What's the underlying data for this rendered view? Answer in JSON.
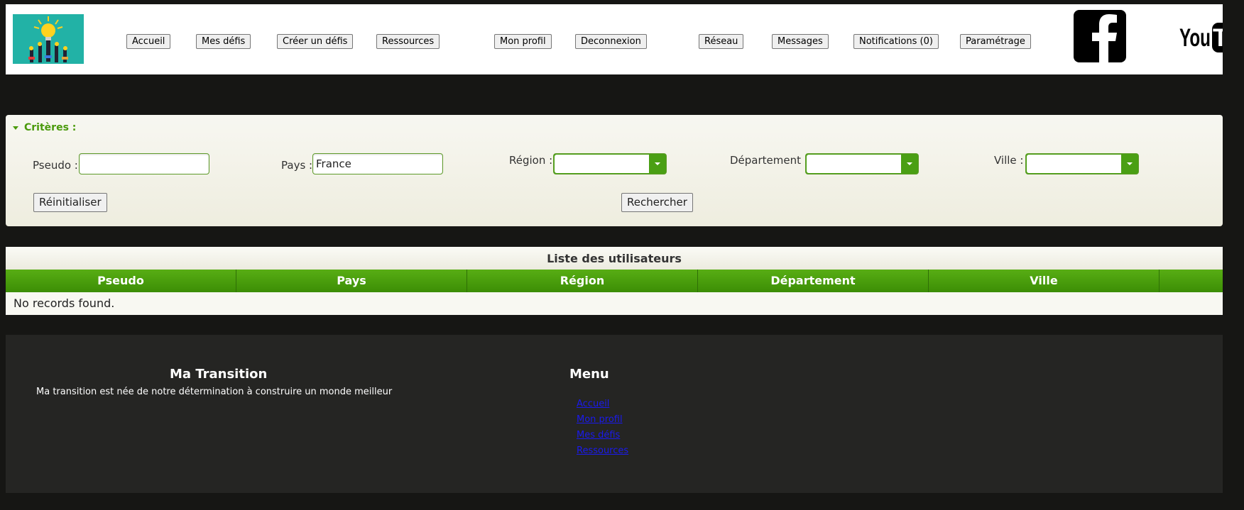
{
  "header": {
    "logo_icon": "lightbulb-hands-logo",
    "nav": [
      {
        "label": "Accueil"
      },
      {
        "label": "Mes défis"
      },
      {
        "label": "Créer un défis"
      },
      {
        "label": "Ressources"
      },
      {
        "label": "Mon profil"
      },
      {
        "label": "Deconnexion"
      },
      {
        "label": "Réseau"
      },
      {
        "label": "Messages"
      },
      {
        "label": "Notifications (0)"
      },
      {
        "label": "Paramétrage"
      }
    ],
    "social": [
      {
        "icon": "facebook-icon"
      },
      {
        "icon": "youtube-icon",
        "text": "YouTub"
      }
    ]
  },
  "criteria": {
    "title": "Critères :",
    "pseudo": {
      "label": "Pseudo :",
      "value": ""
    },
    "pays": {
      "label": "Pays :",
      "value": "France"
    },
    "region": {
      "label": "Région :",
      "value": ""
    },
    "departement": {
      "label": "Département :",
      "value": ""
    },
    "ville": {
      "label": "Ville :",
      "value": ""
    },
    "reset_label": "Réinitialiser",
    "search_label": "Rechercher"
  },
  "users_table": {
    "title": "Liste des utilisateurs",
    "columns": [
      "Pseudo",
      "Pays",
      "Région",
      "Département",
      "Ville"
    ],
    "empty_message": "No records found."
  },
  "footer": {
    "brand_title": "Ma Transition",
    "brand_text": "Ma transition est née de notre détermination à construire un monde meilleur",
    "menu_title": "Menu",
    "menu_links": [
      "Accueil",
      "Mon profil",
      "Mes défis",
      "Ressources"
    ]
  },
  "colors": {
    "accent_green": "#4a9f14",
    "page_background": "#161614",
    "footer_background": "#252523"
  }
}
